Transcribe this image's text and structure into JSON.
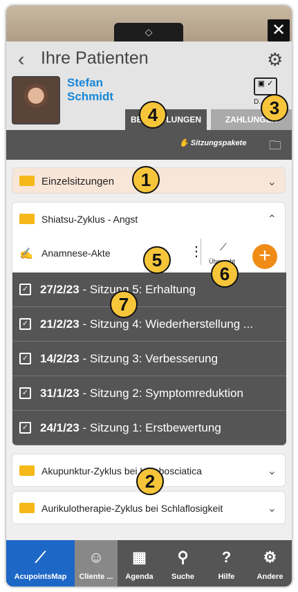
{
  "window": {
    "handle_glyph": "◇",
    "close_label": "✕"
  },
  "header": {
    "back_label": "‹",
    "title": "Ihre Patienten",
    "settings_icon": "gear-icon",
    "patient": {
      "first_name": "Stefan",
      "last_name": "Schmidt"
    },
    "doc_label": "D..."
  },
  "tabs": [
    {
      "label": "BEHANDLUNGEN"
    },
    {
      "label": "ZAHLUNGEN"
    }
  ],
  "toolbar": {
    "packages_label": "Sitzungspakete"
  },
  "groups": [
    {
      "label": "Einzelsitzungen"
    },
    {
      "label": "Shiatsu-Zyklus - Angst"
    },
    {
      "label": "Akupunktur-Zyklus bei Lumbosciatica"
    },
    {
      "label": "Aurikulotherapie-Zyklus bei Schlaflosigkeit"
    }
  ],
  "anamnesis": {
    "label": "Anamnese-Akte",
    "overview_label": "Übersicht",
    "add_label": "+"
  },
  "sessions": [
    {
      "date": "27/2/23",
      "text": "Sitzung 5: Erhaltung"
    },
    {
      "date": "21/2/23",
      "text": "Sitzung 4: Wiederherstellung ..."
    },
    {
      "date": "14/2/23",
      "text": "Sitzung 3: Verbesserung"
    },
    {
      "date": "31/1/23",
      "text": "Sitzung 2: Symptomreduktion"
    },
    {
      "date": "24/1/23",
      "text": "Sitzung 1: Erstbewertung"
    }
  ],
  "badges": [
    "1",
    "2",
    "3",
    "4",
    "5",
    "6",
    "7"
  ],
  "nav": [
    {
      "label": "AcupointsMap"
    },
    {
      "label": "Cliente ..."
    },
    {
      "label": "Agenda"
    },
    {
      "label": "Suche"
    },
    {
      "label": "Hilfe"
    },
    {
      "label": "Andere"
    }
  ]
}
